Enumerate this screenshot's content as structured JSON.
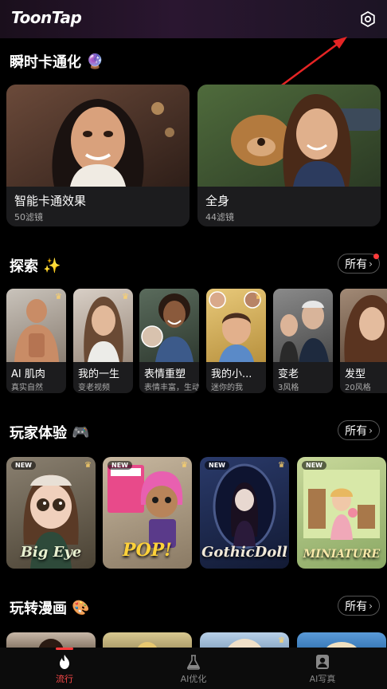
{
  "app": {
    "title": "ToonTap"
  },
  "icons": {
    "settings": "gear-icon",
    "hot": "flame-icon",
    "lab": "flask-icon",
    "portrait": "portrait-icon",
    "chevron": "chevron-right-icon",
    "crown": "crown-icon"
  },
  "sections": {
    "instant": {
      "title": "瞬时卡通化",
      "emoji": "🔮"
    },
    "explore": {
      "title": "探索",
      "emoji": "✨",
      "more": "所有"
    },
    "player": {
      "title": "玩家体验",
      "emoji": "🎮",
      "more": "所有"
    },
    "comic": {
      "title": "玩转漫画",
      "emoji": "🎨",
      "more": "所有"
    }
  },
  "big_cards": [
    {
      "title": "智能卡通效果",
      "subtitle": "50滤镜"
    },
    {
      "title": "全身",
      "subtitle": "44滤镜"
    }
  ],
  "explore_cards": [
    {
      "title": "AI 肌肉",
      "subtitle": "真实自然"
    },
    {
      "title": "我的一生",
      "subtitle": "变老视频"
    },
    {
      "title": "表情重塑",
      "subtitle": "表情丰富，生动有趣"
    },
    {
      "title": "我的小...",
      "subtitle": "迷你的我"
    },
    {
      "title": "变老",
      "subtitle": "3风格"
    },
    {
      "title": "发型",
      "subtitle": "20风格"
    }
  ],
  "player_cards": [
    {
      "label": "Big Eye",
      "tag": "NEW"
    },
    {
      "label": "POP!",
      "tag": "NEW"
    },
    {
      "label": "GothicDoll",
      "tag": "NEW"
    },
    {
      "label": "MINIATURE",
      "tag": "NEW"
    }
  ],
  "nav": [
    {
      "label": "流行",
      "active": true
    },
    {
      "label": "AI优化",
      "active": false
    },
    {
      "label": "AI写真",
      "active": false
    }
  ],
  "colors": {
    "accent": "#ff3b3b",
    "background": "#000000",
    "card": "#1c1c1e"
  }
}
